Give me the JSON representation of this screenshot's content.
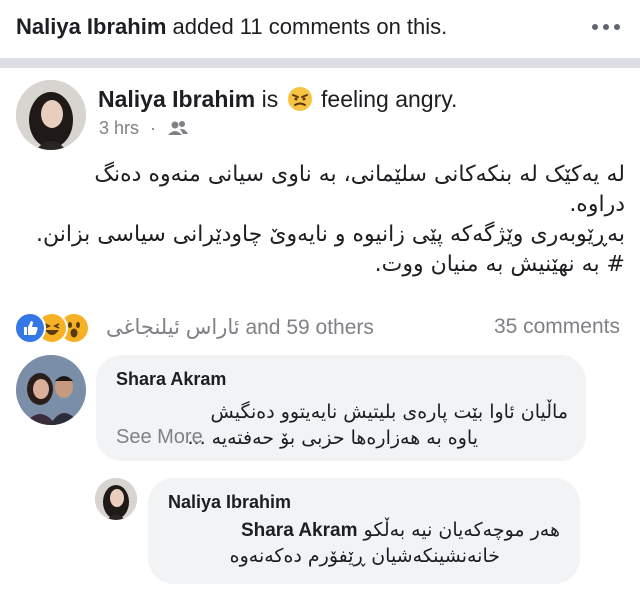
{
  "activity": {
    "actor": "Naliya Ibrahim",
    "text": "added 11 comments on this.",
    "more_icon": "more-horizontal-icon"
  },
  "post": {
    "author": "Naliya Ibrahim",
    "is_word": "is",
    "feeling_icon": "angry-face-icon",
    "feeling": "feeling angry.",
    "time": "3 hrs",
    "dot": "·",
    "audience_icon": "friends-icon",
    "text_lines": [
      "له یەکێک له بنکەکانی سلێمانی، بە ناوی سیانی منەوە دەنگ",
      "دراوە.",
      "بەڕێوبەری وێژگەکە پێی زانیوە و نایەوێ چاودێرانی سیاسی بزانن.",
      "# بە نهێنیش بە منیان ووت."
    ]
  },
  "reactions": {
    "icons": [
      "like-icon",
      "haha-icon",
      "wow-icon"
    ],
    "names": "ئاراس ئیلنجاغی and 59 others",
    "comments": "35 comments",
    "colors": {
      "like": "#3578e5",
      "haha": "#f7b125",
      "wow": "#f7b125"
    }
  },
  "comments": [
    {
      "name": "Shara Akram",
      "lines": [
        "ماڵیان ئاوا بێت پارەی بلیتیش نایەیتوو دەنگیش",
        "یاوە بە هەزارەها حزبی بۆ حەفتەیە ..."
      ],
      "see_more": "See More"
    }
  ],
  "replies": [
    {
      "name": "Naliya Ibrahim",
      "mention": "Shara Akram",
      "line1_rest": "هەر موچەکەیان نیە بەڵکو",
      "line2": "خانەنشینکەشیان ڕێفۆرم دەکەنەوە"
    }
  ]
}
